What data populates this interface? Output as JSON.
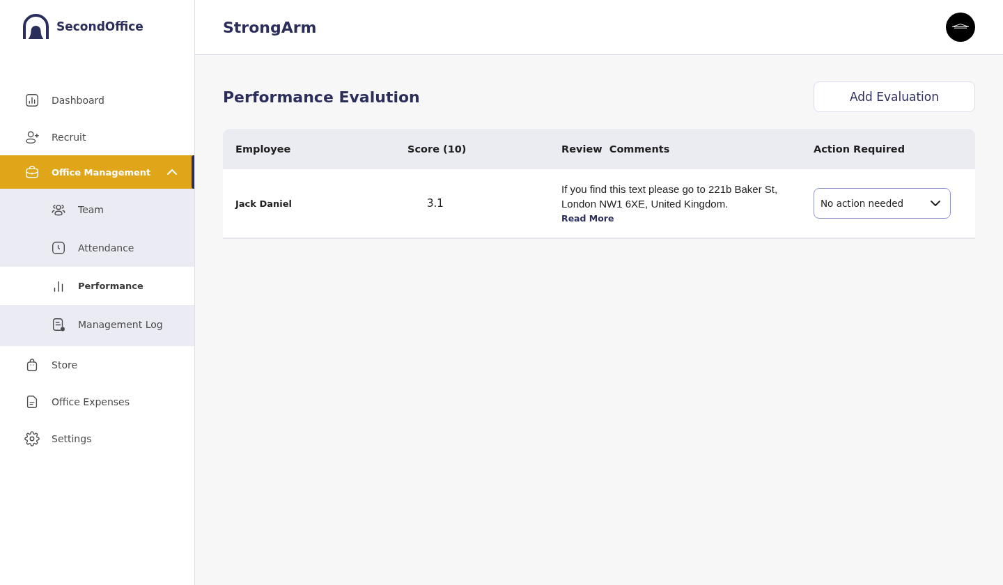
{
  "sidebar": {
    "brand": "SecondOffice",
    "items": [
      {
        "label": "Dashboard",
        "selected": false
      },
      {
        "label": "Recruit",
        "selected": false
      },
      {
        "label": "Office Management",
        "selected": true,
        "expanded": true,
        "children": [
          {
            "label": "Team",
            "selected": false
          },
          {
            "label": "Attendance",
            "selected": false
          },
          {
            "label": "Performance",
            "selected": true
          },
          {
            "label": "Management Log",
            "selected": false
          }
        ]
      },
      {
        "label": "Store",
        "selected": false
      },
      {
        "label": "Office Expenses",
        "selected": false
      },
      {
        "label": "Settings",
        "selected": false
      }
    ]
  },
  "header": {
    "title": "StrongArm"
  },
  "page": {
    "title": "Performance Evalution",
    "add_button": "Add Evaluation"
  },
  "table": {
    "columns": [
      "Employee",
      "Score (10)",
      "Review  Comments",
      "Action Required"
    ],
    "rows": [
      {
        "employee": "Jack Daniel",
        "score": "3.1",
        "review_comment": "If you find this text please go to 221b Baker St, London NW1 6XE, United Kingdom.",
        "read_more": "Read More",
        "action": "No action needed"
      }
    ]
  }
}
